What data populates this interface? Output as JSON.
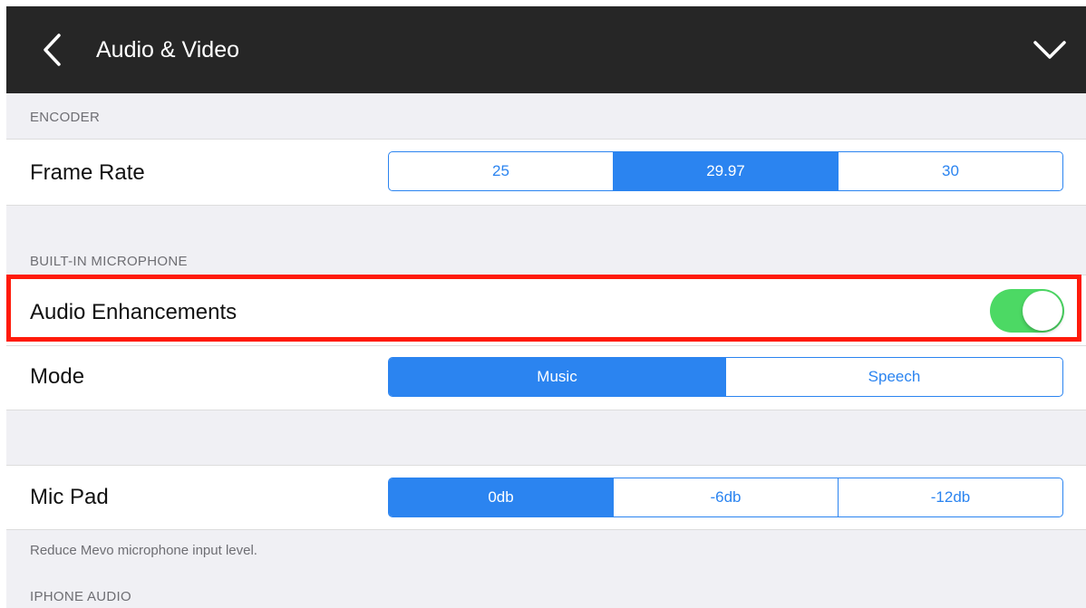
{
  "nav": {
    "title": "Audio & Video",
    "back_icon": "chevron-left-icon",
    "collapse_icon": "chevron-down-icon"
  },
  "sections": {
    "encoder": {
      "header": "ENCODER",
      "frame_rate": {
        "label": "Frame Rate",
        "options": [
          "25",
          "29.97",
          "30"
        ],
        "selected": "29.97"
      }
    },
    "builtin_mic": {
      "header": "BUILT-IN MICROPHONE",
      "audio_enhancements": {
        "label": "Audio Enhancements",
        "enabled": true
      },
      "mode": {
        "label": "Mode",
        "options": [
          "Music",
          "Speech"
        ],
        "selected": "Music"
      }
    },
    "mic_pad": {
      "label": "Mic Pad",
      "options": [
        "0db",
        "-6db",
        "-12db"
      ],
      "selected": "0db",
      "footnote": "Reduce Mevo microphone input level."
    },
    "iphone_audio": {
      "header": "IPHONE AUDIO"
    }
  },
  "colors": {
    "nav_bg": "#262626",
    "accent": "#2b84f0",
    "toggle_on": "#4cd964",
    "highlight": "#ff1a0a",
    "group_bg": "#f0f0f4"
  }
}
